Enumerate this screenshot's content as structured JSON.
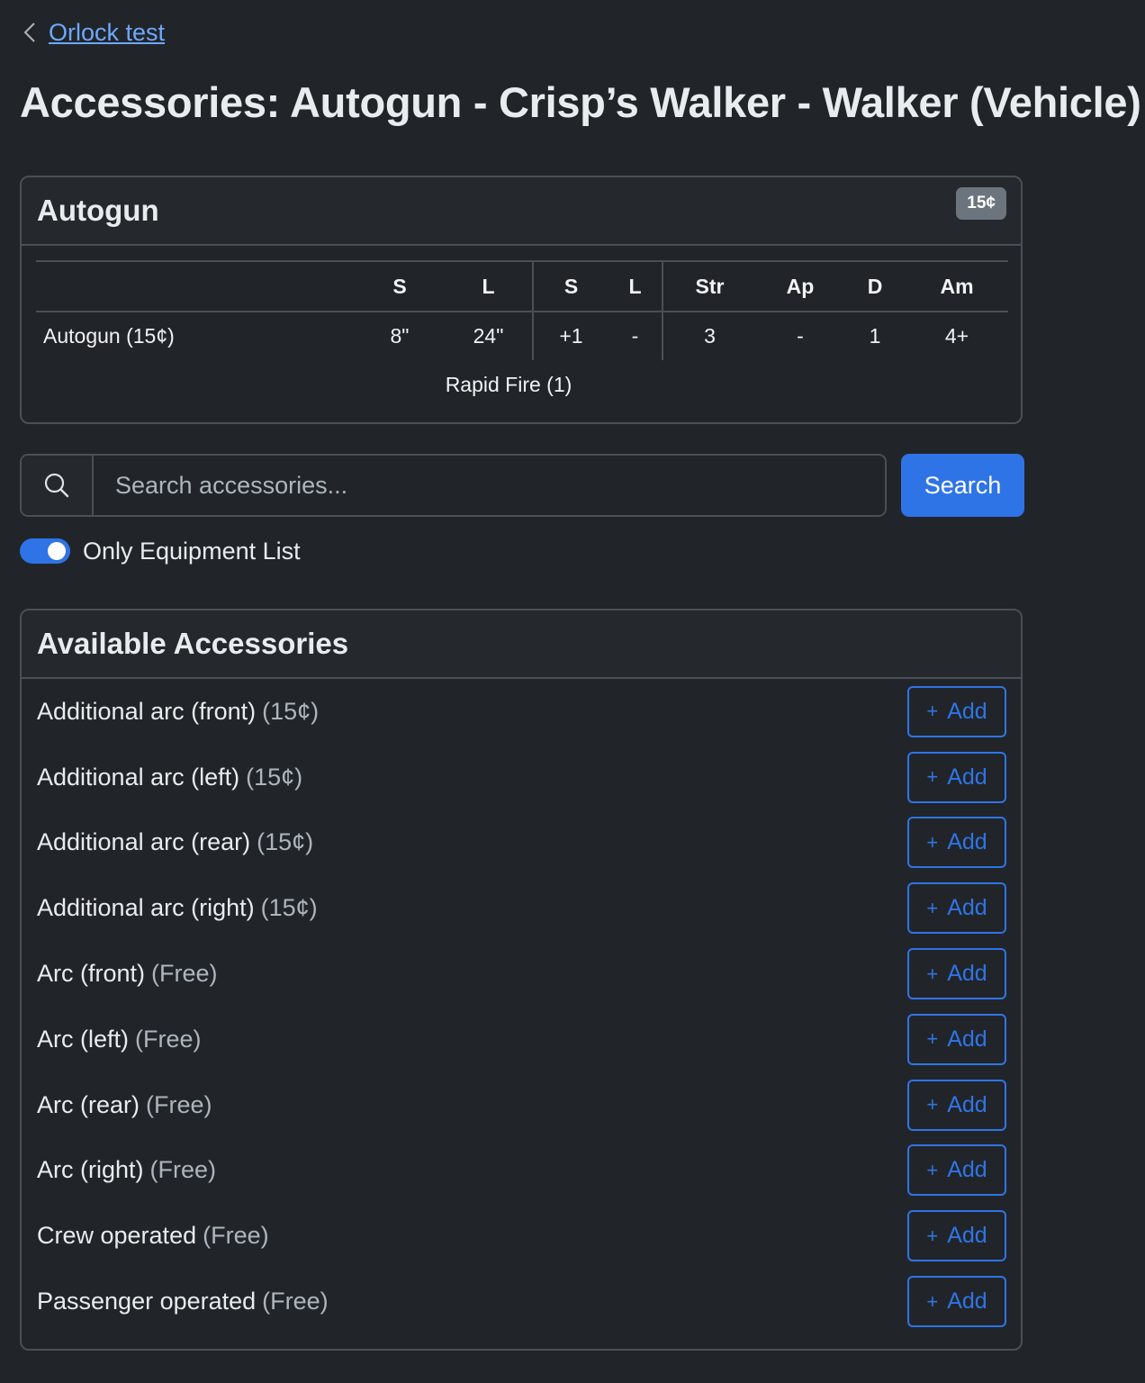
{
  "breadcrumb": {
    "back_label": "Orlock test"
  },
  "page_title": "Accessories: Autogun - Crisp’s Walker - Walker (Vehicle)",
  "weapon": {
    "name": "Autogun",
    "cost_badge": "15¢",
    "headers": [
      "S",
      "L",
      "S",
      "L",
      "Str",
      "Ap",
      "D",
      "Am"
    ],
    "profile": {
      "name": "Autogun (15¢)",
      "values": [
        "8\"",
        "24\"",
        "+1",
        "-",
        "3",
        "-",
        "1",
        "4+"
      ]
    },
    "traits": "Rapid Fire (1)"
  },
  "search": {
    "placeholder": "Search accessories...",
    "button_label": "Search"
  },
  "filter": {
    "label": "Only Equipment List",
    "enabled": true
  },
  "accessories": {
    "title": "Available Accessories",
    "add_label": "Add",
    "items": [
      {
        "name": "Additional arc (front)",
        "cost": "(15¢)"
      },
      {
        "name": "Additional arc (left)",
        "cost": "(15¢)"
      },
      {
        "name": "Additional arc (rear)",
        "cost": "(15¢)"
      },
      {
        "name": "Additional arc (right)",
        "cost": "(15¢)"
      },
      {
        "name": "Arc (front)",
        "cost": "(Free)"
      },
      {
        "name": "Arc (left)",
        "cost": "(Free)"
      },
      {
        "name": "Arc (rear)",
        "cost": "(Free)"
      },
      {
        "name": "Arc (right)",
        "cost": "(Free)"
      },
      {
        "name": "Crew operated",
        "cost": "(Free)"
      },
      {
        "name": "Passenger operated",
        "cost": "(Free)"
      }
    ]
  },
  "colors": {
    "background": "#212529",
    "primary": "#2f74e6",
    "border": "#495057",
    "muted": "#adb5bd"
  }
}
